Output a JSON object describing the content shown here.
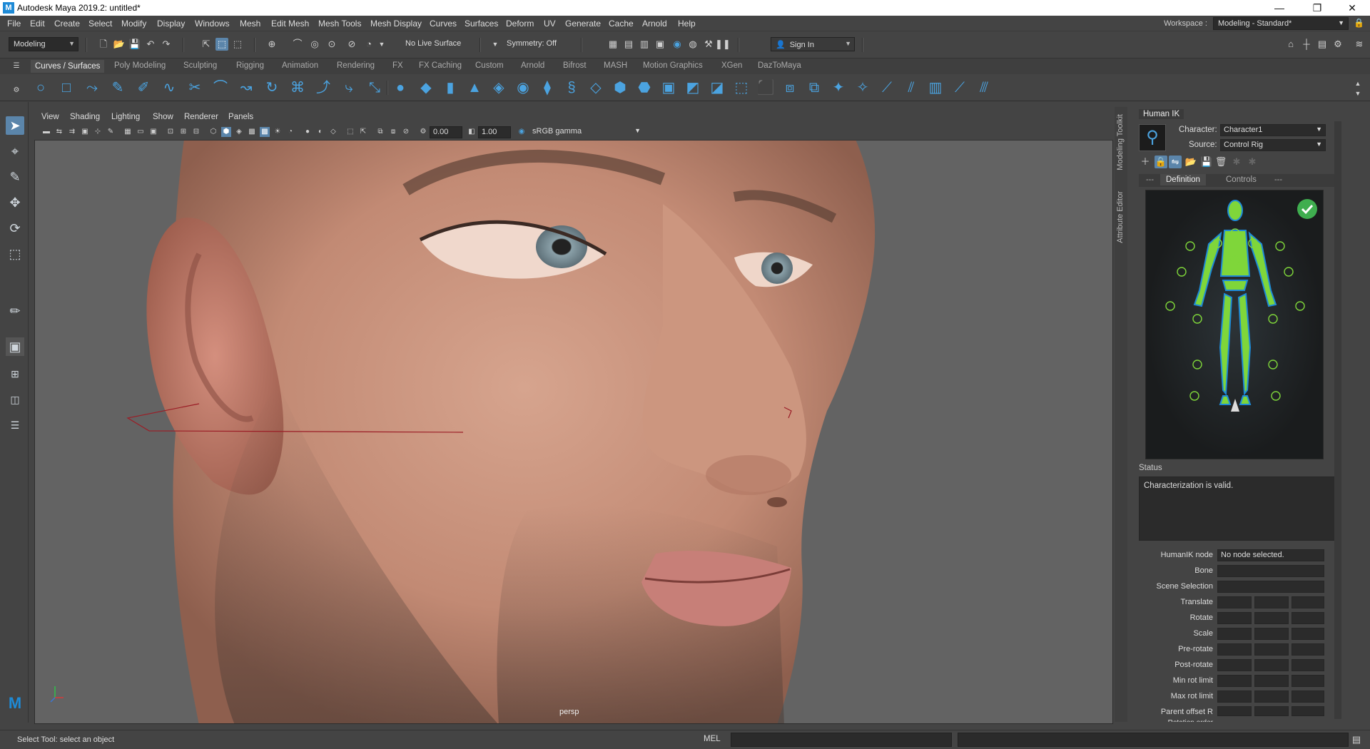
{
  "window": {
    "title": "Autodesk Maya 2019.2: untitled*",
    "logo_letter": "M",
    "controls": [
      "—",
      "❐",
      "✕"
    ]
  },
  "menubar": {
    "items": [
      "File",
      "Edit",
      "Create",
      "Select",
      "Modify",
      "Display",
      "Windows",
      "Mesh",
      "Edit Mesh",
      "Mesh Tools",
      "Mesh Display",
      "Curves",
      "Surfaces",
      "Deform",
      "UV",
      "Generate",
      "Cache",
      "Arnold",
      "Help"
    ],
    "workspace_label": "Workspace :",
    "workspace_value": "Modeling - Standard*"
  },
  "statusline": {
    "mode_value": "Modeling",
    "live_surface": "No Live Surface",
    "symmetry": "Symmetry: Off",
    "sign_in": "Sign In"
  },
  "shelf": {
    "tabs": [
      "Curves / Surfaces",
      "Poly Modeling",
      "Sculpting",
      "Rigging",
      "Animation",
      "Rendering",
      "FX",
      "FX Caching",
      "Custom",
      "Arnold",
      "Bifrost",
      "MASH",
      "Motion Graphics",
      "XGen",
      "DazToMaya"
    ],
    "active_tab": "Curves / Surfaces"
  },
  "panel": {
    "menus": [
      "View",
      "Shading",
      "Lighting",
      "Show",
      "Renderer",
      "Panels"
    ],
    "exposure": "0.00",
    "gamma": "1.00",
    "color_space": "sRGB gamma",
    "camera_label": "persp"
  },
  "side_tabs": [
    "Modeling Toolkit",
    "Attribute Editor"
  ],
  "humanik": {
    "tab_title": "Human IK",
    "character_label": "Character:",
    "character_value": "Character1",
    "source_label": "Source:",
    "source_value": "Control Rig",
    "tabs": [
      "---",
      "Definition",
      "Controls",
      "---"
    ],
    "active_tab": "Definition",
    "status_label": "Status",
    "status_text": "Characterization is valid.",
    "node_label": "HumanIK node",
    "node_value": "No node selected.",
    "attributes": [
      "Bone",
      "Scene Selection",
      "Translate",
      "Rotate",
      "Scale",
      "Pre-rotate",
      "Post-rotate",
      "Min rot limit",
      "Max rot limit",
      "Parent offset R",
      "Rotation order"
    ]
  },
  "helpline": {
    "text": "Select Tool: select an object",
    "mel_label": "MEL"
  },
  "colors": {
    "accent": "#5b85aa",
    "shelf_icon": "#4ba3e0",
    "hik_green": "#7fd63a",
    "hik_blue": "#1e8ad6"
  }
}
